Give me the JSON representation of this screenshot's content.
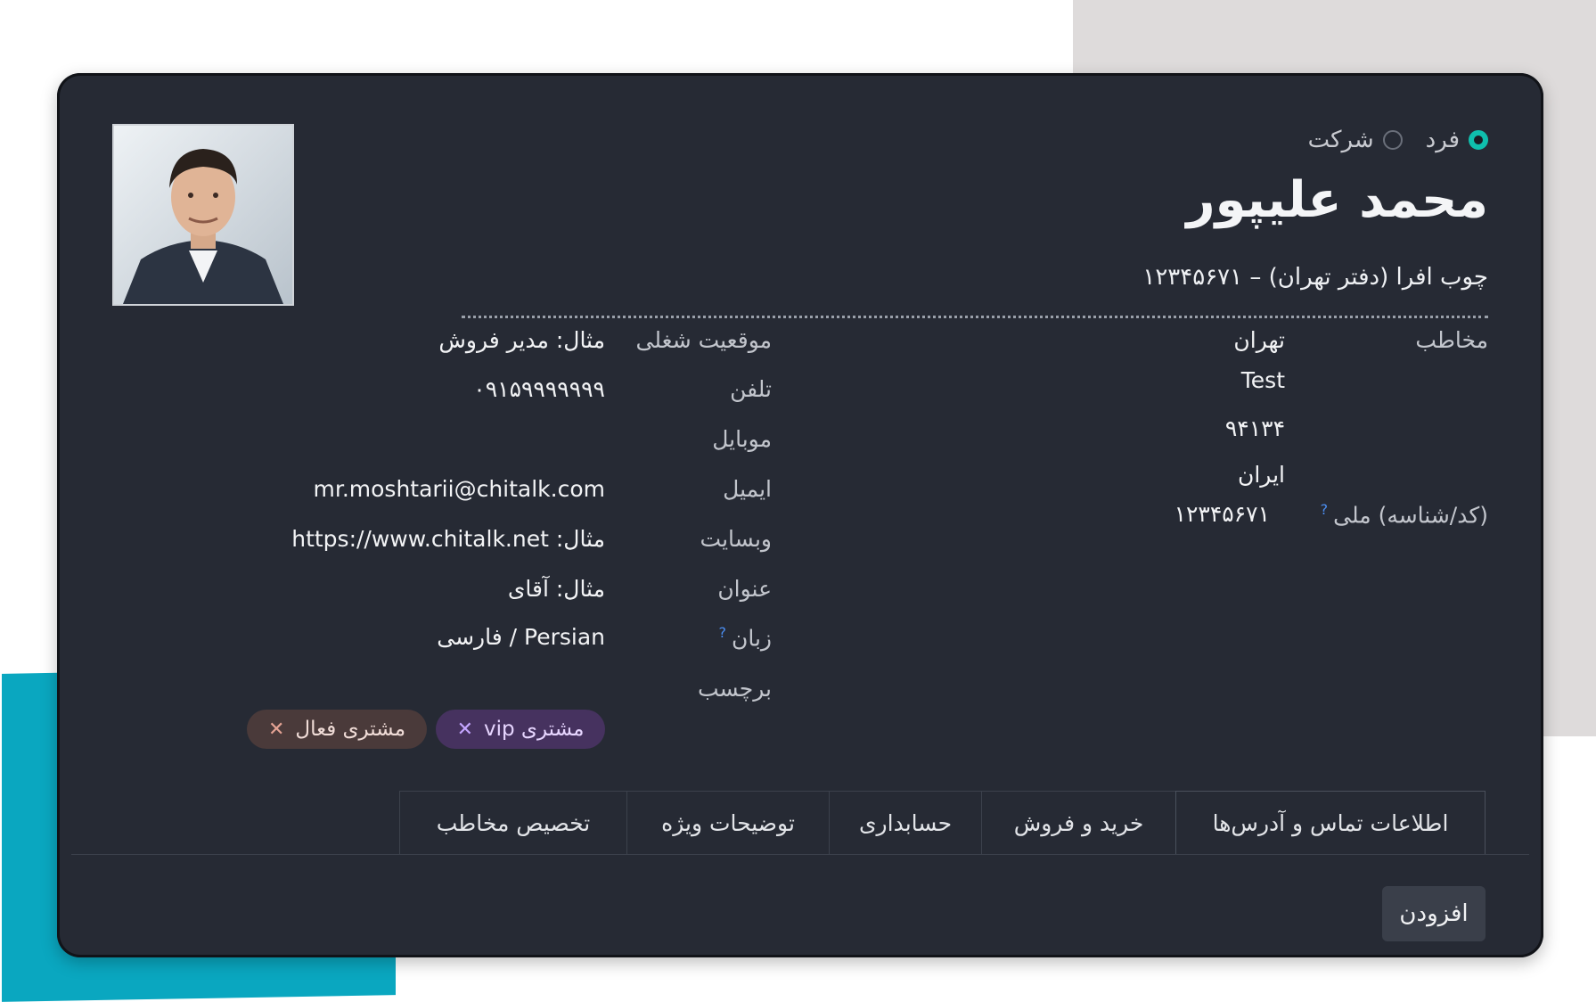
{
  "contact_type": {
    "options": [
      "فرد",
      "شرکت"
    ],
    "selected": "فرد"
  },
  "name": "محمد علیپور",
  "company": "چوب افرا (دفتر تهران) – ۱۲۳۴۵۶۷۱",
  "left_column": {
    "contact_label": "مخاطب",
    "city": "تهران",
    "street": "Test",
    "zip": "۹۴۱۳۴",
    "country": "ایران",
    "national_id_label": "(کد/شناسه) ملی",
    "national_id_help": "?",
    "national_id_value": "۱۲۳۴۵۶۷۱"
  },
  "right_column": {
    "job_label": "موقعیت شغلی",
    "job_value": "مثال: مدیر فروش",
    "phone_label": "تلفن",
    "phone_value": "۰۹۱۵۹۹۹۹۹۹۹",
    "mobile_label": "موبایل",
    "email_label": "ایمیل",
    "email_value": "mr.moshtarii@chitalk.com",
    "website_label": "وبسایت",
    "website_value": "مثال: https://www.chitalk.net",
    "title_label": "عنوان",
    "title_value": "مثال: آقای",
    "language_label": "زبان",
    "language_help": "?",
    "language_value": "Persian / فارسی",
    "tags_label": "برچسب",
    "tags": [
      {
        "label": "مشتری vip",
        "color": "#46325f"
      },
      {
        "label": "مشتری فعال",
        "color": "#4a3a3a"
      }
    ],
    "tag_remove_icon": "✕"
  },
  "tabs": [
    "اطلاعات تماس و آدرس‌ها",
    "خرید و فروش",
    "حسابداری",
    "توضیحات ویژه",
    "تخصیص مخاطب"
  ],
  "active_tab": "اطلاعات تماس و آدرس‌ها",
  "add_button": "افزودن",
  "colors": {
    "card_bg": "#262a34",
    "accent_radio": "#0fbfad",
    "help": "#4b8df0"
  }
}
